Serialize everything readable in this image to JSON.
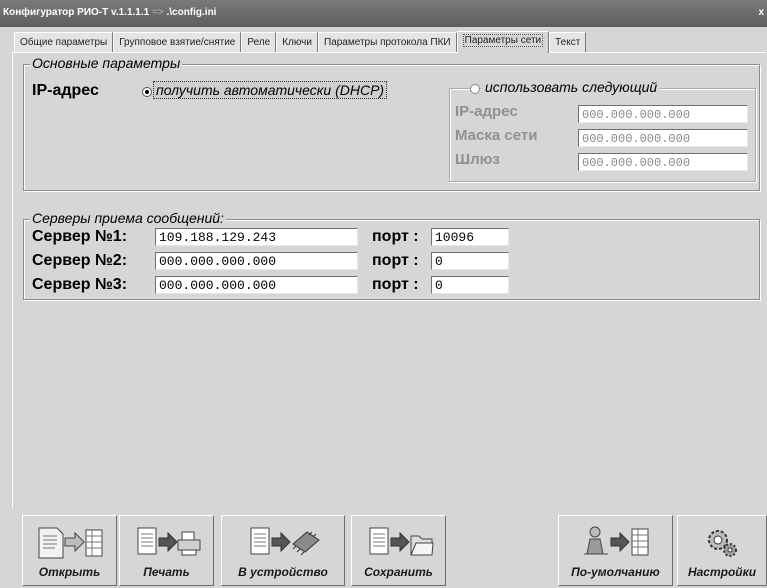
{
  "window": {
    "title": "Конфигуратор РИО-Т v.1.1.1.1",
    "arrow": "=>",
    "config_path": ".\\config.ini",
    "close_glyph": "x"
  },
  "tabs": [
    {
      "label": "Общие параметры",
      "active": false
    },
    {
      "label": "Групповое взятие/снятие",
      "active": false
    },
    {
      "label": "Реле",
      "active": false
    },
    {
      "label": "Ключи",
      "active": false
    },
    {
      "label": "Параметры протокола ПКИ",
      "active": false
    },
    {
      "label": "Параметры сети",
      "active": true
    },
    {
      "label": "Текст",
      "active": false
    }
  ],
  "basic": {
    "legend": "Основные параметры",
    "ip_label": "IP-адрес",
    "dhcp_option": "получить автоматически (DHCP)",
    "dhcp_selected": true,
    "manual_option": "использовать следующий",
    "manual_selected": false,
    "manual_ip_label": "IP-адрес",
    "mask_label": "Маска сети",
    "gateway_label": "Шлюз",
    "manual_ip_value": "000.000.000.000",
    "mask_value": "000.000.000.000",
    "gateway_value": "000.000.000.000"
  },
  "servers": {
    "legend": "Серверы приема сообщений:",
    "port_label": "порт :",
    "rows": [
      {
        "label": "Сервер №1:",
        "address": "109.188.129.243",
        "port": "10096"
      },
      {
        "label": "Сервер №2:",
        "address": "000.000.000.000",
        "port": "0"
      },
      {
        "label": "Сервер №3:",
        "address": "000.000.000.000",
        "port": "0"
      }
    ]
  },
  "toolbar": {
    "open": "Открыть",
    "print": "Печать",
    "to_device": "В устройство",
    "save": "Сохранить",
    "defaults": "По-умолчанию",
    "settings": "Настройки"
  },
  "icons": {
    "open": "document-to-sheet-icon",
    "print": "document-to-printer-icon",
    "to_device": "document-to-chip-icon",
    "save": "document-to-folder-icon",
    "defaults": "person-to-sheet-icon",
    "settings": "gears-icon"
  }
}
